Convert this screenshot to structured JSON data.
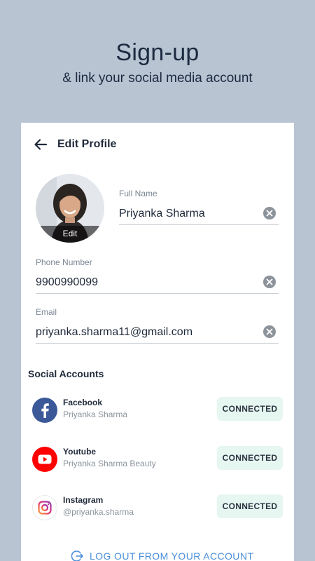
{
  "hero": {
    "title": "Sign-up",
    "subtitle": "& link your social media account"
  },
  "header": {
    "title": "Edit Profile",
    "back_icon": "arrow-left-icon"
  },
  "avatar": {
    "edit_label": "Edit"
  },
  "fields": {
    "full_name": {
      "label": "Full Name",
      "value": "Priyanka Sharma"
    },
    "phone": {
      "label": "Phone Number",
      "value": "9900990099"
    },
    "email": {
      "label": "Email",
      "value": "priyanka.sharma11@gmail.com"
    }
  },
  "social": {
    "title": "Social Accounts",
    "accounts": [
      {
        "name": "Facebook",
        "handle": "Priyanka Sharma",
        "status": "CONNECTED",
        "icon": "facebook-icon",
        "color": "#3b5998"
      },
      {
        "name": "Youtube",
        "handle": "Priyanka Sharma Beauty",
        "status": "CONNECTED",
        "icon": "youtube-icon",
        "color": "#ff0000"
      },
      {
        "name": "Instagram",
        "handle": "@priyanka.sharma",
        "status": "CONNECTED",
        "icon": "instagram-icon",
        "color": "#e1306c"
      }
    ]
  },
  "logout": {
    "label": "LOG OUT FROM YOUR ACCOUNT",
    "icon": "logout-icon"
  },
  "colors": {
    "background": "#b9c4d3",
    "accent": "#4a8ed8",
    "connected_bg": "#e6f6f1"
  }
}
